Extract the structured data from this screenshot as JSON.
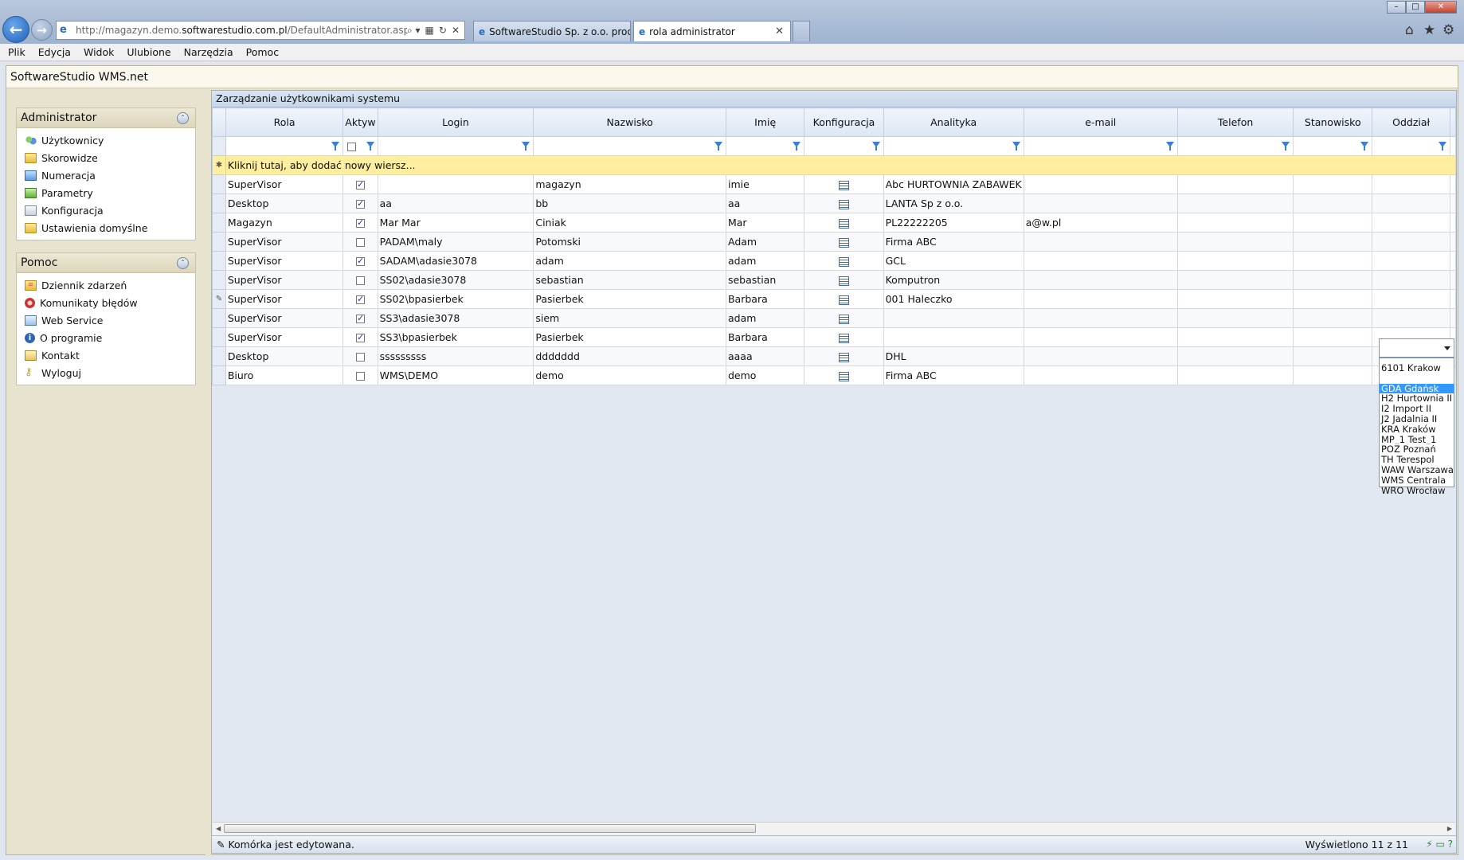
{
  "browser": {
    "url_prefix": "http://magazyn.demo.",
    "url_domain": "softwarestudio.com.pl",
    "url_path": "/DefaultAdministrator.aspx",
    "tabs": [
      {
        "label": "SoftwareStudio Sp. z o.o. prod..."
      },
      {
        "label": "rola administrator"
      }
    ]
  },
  "menu": [
    "Plik",
    "Edycja",
    "Widok",
    "Ulubione",
    "Narzędzia",
    "Pomoc"
  ],
  "app": {
    "title": "SoftwareStudio WMS.net"
  },
  "sidebar": {
    "admin": {
      "title": "Administrator",
      "items": [
        {
          "label": "Użytkownicy",
          "icon": "users-icon"
        },
        {
          "label": "Skorowidze",
          "icon": "folder-icon"
        },
        {
          "label": "Numeracja",
          "icon": "numbering-icon"
        },
        {
          "label": "Parametry",
          "icon": "parameters-icon"
        },
        {
          "label": "Konfiguracja",
          "icon": "config-icon"
        },
        {
          "label": "Ustawienia domyślne",
          "icon": "folder-icon"
        }
      ]
    },
    "help": {
      "title": "Pomoc",
      "items": [
        {
          "label": "Dziennik zdarzeń",
          "icon": "log-icon"
        },
        {
          "label": "Komunikaty błędów",
          "icon": "error-icon"
        },
        {
          "label": "Web Service",
          "icon": "webservice-icon"
        },
        {
          "label": "O programie",
          "icon": "info-icon"
        },
        {
          "label": "Kontakt",
          "icon": "contact-icon"
        },
        {
          "label": "Wyloguj",
          "icon": "key-icon"
        }
      ]
    }
  },
  "grid": {
    "title": "Zarządzanie użytkownikami systemu",
    "columns": [
      "Rola",
      "Aktyw",
      "Login",
      "Nazwisko",
      "Imię",
      "Konfiguracja",
      "Analityka",
      "e-mail",
      "Telefon",
      "Stanowisko",
      "Oddział"
    ],
    "add_row_text": "Kliknij tutaj, aby dodać nowy wiersz...",
    "rows": [
      {
        "rola": "SuperVisor",
        "aktyw": true,
        "login": "",
        "nazwisko": "magazyn",
        "imie": "imie",
        "analityka": "Abc HURTOWNIA ZABAWEK",
        "email": ""
      },
      {
        "rola": "Desktop",
        "aktyw": true,
        "login": "aa",
        "nazwisko": "bb",
        "imie": "aa",
        "analityka": "LANTA Sp z o.o.",
        "email": ""
      },
      {
        "rola": "Magazyn",
        "aktyw": true,
        "login": "Mar Mar",
        "nazwisko": "Ciniak",
        "imie": "Mar",
        "analityka": "PL22222205",
        "email": "a@w.pl"
      },
      {
        "rola": "SuperVisor",
        "aktyw": false,
        "login": "PADAM\\maly",
        "nazwisko": "Potomski",
        "imie": "Adam",
        "analityka": "Firma ABC",
        "email": ""
      },
      {
        "rola": "SuperVisor",
        "aktyw": true,
        "login": "SADAM\\adasie3078",
        "nazwisko": "adam",
        "imie": "adam",
        "analityka": "GCL",
        "email": ""
      },
      {
        "rola": "SuperVisor",
        "aktyw": false,
        "login": "SS02\\adasie3078",
        "nazwisko": "sebastian",
        "imie": "sebastian",
        "analityka": "Komputron",
        "email": ""
      },
      {
        "rola": "SuperVisor",
        "aktyw": true,
        "login": "SS02\\bpasierbek",
        "nazwisko": "Pasierbek",
        "imie": "Barbara",
        "analityka": "001 Haleczko",
        "email": "",
        "editing": true
      },
      {
        "rola": "SuperVisor",
        "aktyw": true,
        "login": "SS3\\adasie3078",
        "nazwisko": "siem",
        "imie": "adam",
        "analityka": "",
        "email": ""
      },
      {
        "rola": "SuperVisor",
        "aktyw": true,
        "login": "SS3\\bpasierbek",
        "nazwisko": "Pasierbek",
        "imie": "Barbara",
        "analityka": "",
        "email": ""
      },
      {
        "rola": "Desktop",
        "aktyw": false,
        "login": "sssssssss",
        "nazwisko": "ddddddd",
        "imie": "aaaa",
        "analityka": "DHL",
        "email": ""
      },
      {
        "rola": "Biuro",
        "aktyw": false,
        "login": "WMS\\DEMO",
        "nazwisko": "demo",
        "imie": "demo",
        "analityka": "Firma ABC",
        "email": ""
      }
    ],
    "dropdown": {
      "options": [
        "6101 Krakow",
        "",
        "GDA Gdańsk",
        "H2 Hurtownia II",
        "I2 Import II",
        "J2 Jadalnia II",
        "KRA Kraków",
        "MP_1 Test_1",
        "POZ Poznań",
        "TH Terespol",
        "WAW Warszawa",
        "WMS Centrala",
        "WRO Wrocław"
      ],
      "selected": "GDA Gdańsk"
    }
  },
  "status": {
    "left": "Komórka jest edytowana.",
    "right": "Wyświetlono 11 z 11"
  }
}
